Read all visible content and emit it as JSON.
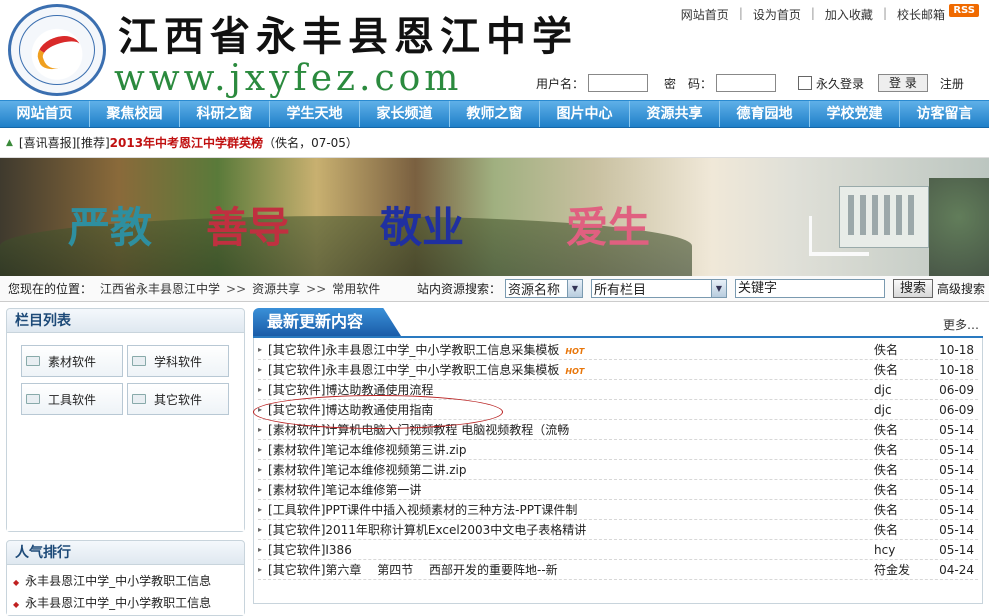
{
  "header": {
    "school_name": "江西省永丰县恩江中学",
    "url": "www.jxyfez.com",
    "toplinks": [
      "网站首页",
      "设为首页",
      "加入收藏",
      "校长邮箱"
    ],
    "rss": "RSS",
    "login": {
      "username_label": "用户名：",
      "password_label": "密　码：",
      "remember_label": "永久登录",
      "login_button": "登 录",
      "register": "注册"
    }
  },
  "nav": [
    "网站首页",
    "聚焦校园",
    "科研之窗",
    "学生天地",
    "家长频道",
    "教师之窗",
    "图片中心",
    "资源共享",
    "德育园地",
    "学校党建",
    "访客留言"
  ],
  "ticker": {
    "prefix": "[喜讯喜报][推荐]",
    "headline": "2013年中考恩江中学群英榜",
    "meta": "（佚名，07-05）"
  },
  "banner": {
    "words": [
      "严教",
      "善导",
      "敬业",
      "爱生"
    ],
    "word_colors": [
      "#2e8fa0",
      "#c03040",
      "#2030a0",
      "#e06080"
    ]
  },
  "location": {
    "label": "您现在的位置：",
    "path": [
      "江西省永丰县恩江中学",
      "资源共享",
      "常用软件"
    ],
    "separator": ">>"
  },
  "search": {
    "label": "站内资源搜索：",
    "field": "资源名称",
    "column": "所有栏目",
    "keyword": "关键字",
    "button": "搜索",
    "advanced": "高级搜索"
  },
  "sidebar": {
    "categories_title": "栏目列表",
    "categories": [
      "素材软件",
      "学科软件",
      "工具软件",
      "其它软件"
    ],
    "popular_title": "人气排行",
    "popular": [
      "永丰县恩江中学_中小学教职工信息",
      "永丰县恩江中学_中小学教职工信息"
    ]
  },
  "updates": {
    "title": "最新更新内容",
    "more": "更多…",
    "hot_badge": "HOT",
    "rows": [
      {
        "title": "[其它软件]永丰县恩江中学_中小学教职工信息采集模板",
        "hot": true,
        "author": "佚名",
        "date": "10-18"
      },
      {
        "title": "[其它软件]永丰县恩江中学_中小学教职工信息采集模板",
        "hot": true,
        "author": "佚名",
        "date": "10-18"
      },
      {
        "title": "[其它软件]博达助教通使用流程",
        "hot": false,
        "author": "djc",
        "date": "06-09"
      },
      {
        "title": "[其它软件]博达助教通使用指南",
        "hot": false,
        "author": "djc",
        "date": "06-09"
      },
      {
        "title": "[素材软件]计算机电脑入门视频教程 电脑视频教程（流畅",
        "hot": false,
        "author": "佚名",
        "date": "05-14"
      },
      {
        "title": "[素材软件]笔记本维修视频第三讲.zip",
        "hot": false,
        "author": "佚名",
        "date": "05-14"
      },
      {
        "title": "[素材软件]笔记本维修视频第二讲.zip",
        "hot": false,
        "author": "佚名",
        "date": "05-14"
      },
      {
        "title": "[素材软件]笔记本维修第一讲",
        "hot": false,
        "author": "佚名",
        "date": "05-14"
      },
      {
        "title": "[工具软件]PPT课件中插入视频素材的三种方法-PPT课件制",
        "hot": false,
        "author": "佚名",
        "date": "05-14"
      },
      {
        "title": "[其它软件]2011年职称计算机Excel2003中文电子表格精讲",
        "hot": false,
        "author": "佚名",
        "date": "05-14"
      },
      {
        "title": "[其它软件]I386",
        "hot": false,
        "author": "hcy",
        "date": "05-14"
      },
      {
        "title": "[其它软件]第六章　 第四节　 西部开发的重要阵地--新",
        "hot": false,
        "author": "符金发",
        "date": "04-24"
      }
    ]
  }
}
